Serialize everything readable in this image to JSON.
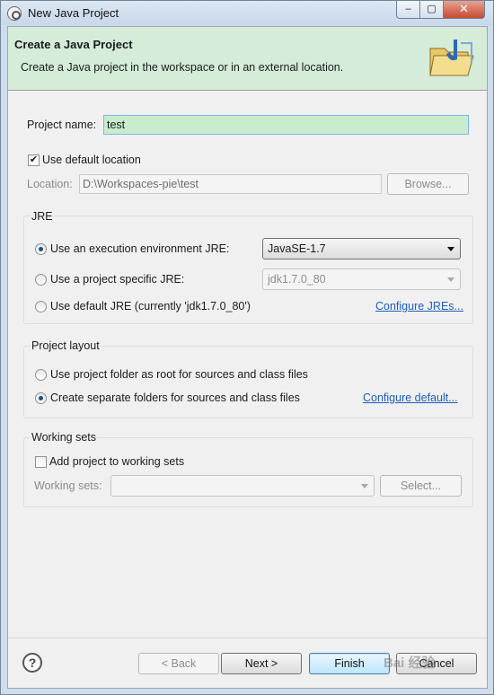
{
  "window": {
    "title": "New Java Project",
    "buttons": {
      "minimize": "–",
      "maximize": "▢",
      "close": "✕"
    }
  },
  "banner": {
    "title": "Create a Java Project",
    "description": "Create a Java project in the workspace or in an external location.",
    "icon": "java-project-folder-icon"
  },
  "project": {
    "name_label": "Project name:",
    "name_value": "test",
    "use_default_location_label": "Use default location",
    "use_default_location_checked": true,
    "location_label": "Location:",
    "location_value": "D:\\Workspaces-pie\\test",
    "browse_label": "Browse..."
  },
  "jre": {
    "group_title": "JRE",
    "option_exec_env_label": "Use an execution environment JRE:",
    "exec_env_value": "JavaSE-1.7",
    "option_specific_label": "Use a project specific JRE:",
    "specific_value": "jdk1.7.0_80",
    "option_default_label": "Use default JRE (currently 'jdk1.7.0_80')",
    "configure_link": "Configure JREs...",
    "selected": "exec_env"
  },
  "layout": {
    "group_title": "Project layout",
    "option_root_label": "Use project folder as root for sources and class files",
    "option_separate_label": "Create separate folders for sources and class files",
    "configure_link": "Configure default...",
    "selected": "separate"
  },
  "working_sets": {
    "group_title": "Working sets",
    "add_label": "Add project to working sets",
    "add_checked": false,
    "sets_label": "Working sets:",
    "sets_value": "",
    "select_label": "Select..."
  },
  "footer": {
    "help_label": "?",
    "back_label": "< Back",
    "next_label": "Next >",
    "finish_label": "Finish",
    "cancel_label": "Cancel"
  },
  "watermark": "Bai 经验"
}
